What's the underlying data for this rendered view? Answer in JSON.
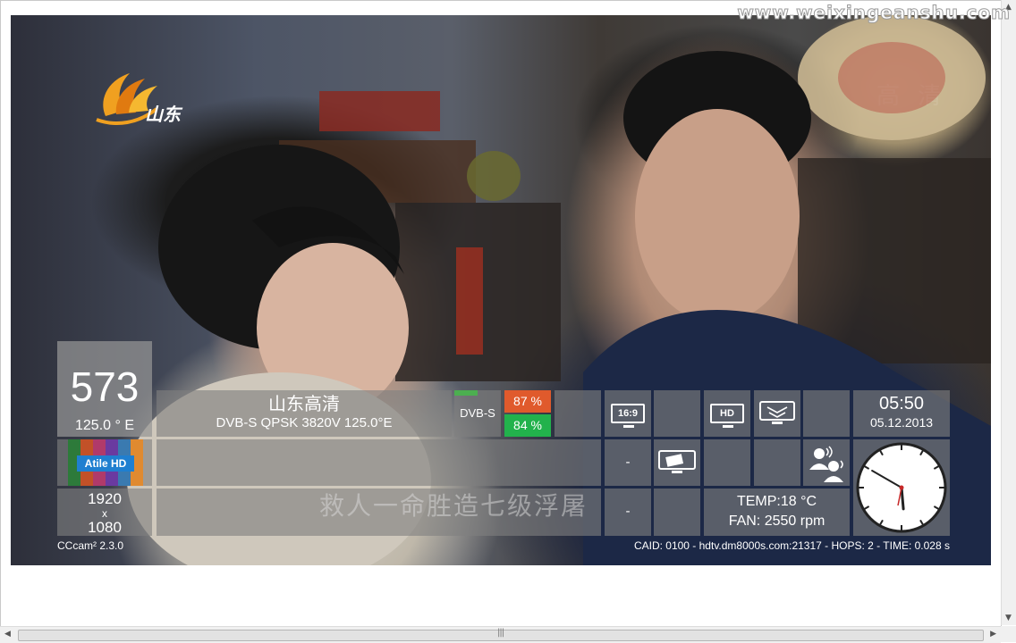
{
  "watermark": "www.weixingeanshu.com",
  "video": {
    "channel_logo_text": "山东",
    "hd_corner_text": "高 清",
    "subtitle": "救人一命胜造七级浮屠"
  },
  "osd": {
    "channel_number": "573",
    "orbital_position": "125.0 ° E",
    "channel_name": "山东高清",
    "transponder": "DVB-S QPSK 3820V 125.0°E",
    "tuner_type": "DVB-S",
    "signal_strength": "87 %",
    "signal_quality": "84 %",
    "aspect_icon_label": "16:9",
    "hd_icon_label": "HD",
    "time": "05:50",
    "date": "05.12.2013",
    "provider_label": "Atile HD",
    "resolution_width": "1920",
    "resolution_sep": "x",
    "resolution_height": "1080",
    "dash_1": "-",
    "dash_2": "-",
    "temperature": "TEMP:18 °C",
    "fan": "FAN: 2550 rpm",
    "softcam": "CCcam² 2.3.0",
    "ecm_info": "CAID: 0100 - hdtv.dm8000s.com:21317 - HOPS: 2 - TIME: 0.028 s",
    "clock_analog": {
      "hour": 5,
      "minute": 50
    },
    "colors": {
      "strength": "#e05a2c",
      "quality": "#22b24c",
      "provider_badge": "#1f7fd0"
    }
  },
  "icons": [
    "tv-16-9-icon",
    "tv-hd-icon",
    "broadcast-icon",
    "card-reader-icon",
    "users-icon",
    "analog-clock-icon"
  ]
}
